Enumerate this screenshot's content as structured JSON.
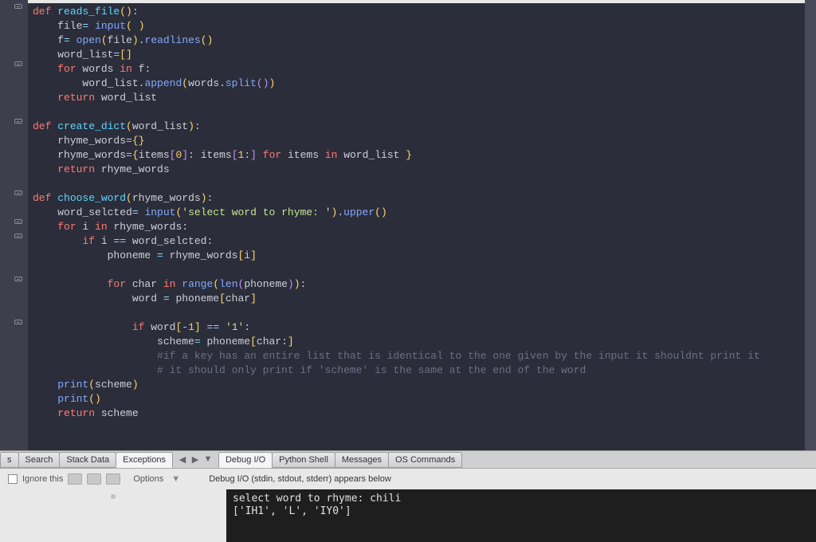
{
  "code": {
    "fn1": "reads_file",
    "fn2": "create_dict",
    "fn3": "choose_word",
    "str_prompt": "'select word to rhyme: '",
    "str_one": "'1'",
    "comment1": "#if a key has an entire list that is identical to the one given by the input it shouldnt print it",
    "comment2": "# it should only print if 'scheme' is the same at the end of the word"
  },
  "tabs": {
    "t_search_partial": "s",
    "t_search": "Search",
    "t_stack": "Stack Data",
    "t_exceptions": "Exceptions",
    "t_debugio": "Debug I/O",
    "t_pyshell": "Python Shell",
    "t_messages": "Messages",
    "t_oscmd": "OS Commands"
  },
  "options": {
    "ignore": "Ignore this",
    "options_label": "Options",
    "status": "Debug I/O (stdin, stdout, stderr) appears below"
  },
  "console": {
    "line1": "select word to rhyme: chili",
    "line2": "['IH1', 'L', 'IY0']"
  }
}
